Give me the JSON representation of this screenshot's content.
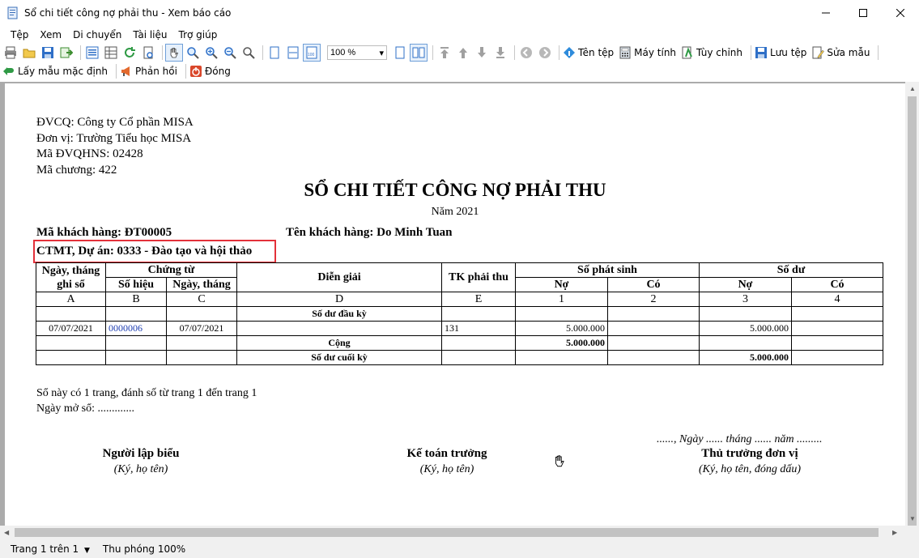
{
  "window": {
    "title": "Sổ chi tiết công nợ phải thu - Xem báo cáo"
  },
  "menu": {
    "items": [
      "Tệp",
      "Xem",
      "Di chuyển",
      "Tài liệu",
      "Trợ giúp"
    ]
  },
  "toolbar": {
    "zoom_value": "100 %",
    "labeled_buttons": [
      "Tên tệp",
      "Máy tính",
      "Tùy chỉnh",
      "Lưu tệp",
      "Sửa mẫu"
    ],
    "row2_buttons": [
      "Lấy mẫu mặc định",
      "Phản hồi",
      "Đóng"
    ]
  },
  "report": {
    "header_lines": [
      "ĐVCQ: Công ty Cổ phần MISA",
      "Đơn vị: Trường Tiểu học MISA",
      "Mã ĐVQHNS: 02428",
      "Mã chương: 422"
    ],
    "title": "SỔ CHI TIẾT CÔNG NỢ PHẢI THU",
    "year": "Năm 2021",
    "customer_code": "Mã khách hàng: ĐT00005",
    "customer_name": "Tên khách hàng: Do Minh Tuan",
    "project": "CTMT, Dự án: 0333 - Đào tạo và hội thảo",
    "columns": {
      "date": "Ngày, tháng ghi sổ",
      "voucher": "Chứng từ",
      "voucher_no": "Số hiệu",
      "voucher_date": "Ngày, tháng",
      "description": "Diễn giải",
      "account": "TK phải thu",
      "movement": "Số phát sinh",
      "balance": "Số dư",
      "debit": "Nợ",
      "credit": "Có",
      "debit2": "Nợ",
      "credit2": "Có"
    },
    "column_codes": [
      "A",
      "B",
      "C",
      "D",
      "E",
      "1",
      "2",
      "3",
      "4"
    ],
    "opening_label": "Số dư đầu kỳ",
    "rows": [
      {
        "date": "07/07/2021",
        "voucher_no": "0000006",
        "voucher_date": "07/07/2021",
        "description": "",
        "account": "131",
        "debit": "5.000.000",
        "credit": "",
        "bal_debit": "5.000.000",
        "bal_credit": ""
      }
    ],
    "total_label": "Cộng",
    "total_debit": "5.000.000",
    "closing_label": "Số dư cuối kỳ",
    "closing_debit": "5.000.000",
    "page_note": "Sổ này có 1 trang, đánh số từ trang 1 đến trang 1",
    "open_date": "Ngày mở sổ: .............",
    "date_line": "......, Ngày ...... tháng ...... năm .........",
    "signatures": [
      {
        "title": "Người lập biểu",
        "sub": "(Ký, họ tên)"
      },
      {
        "title": "Kế toán trưởng",
        "sub": "(Ký, họ tên)"
      },
      {
        "title": "Thủ trưởng đơn vị",
        "sub": "(Ký, họ tên, đóng dấu)"
      }
    ]
  },
  "status": {
    "page": "Trang 1 trên 1",
    "zoom": "Thu phóng 100%"
  }
}
